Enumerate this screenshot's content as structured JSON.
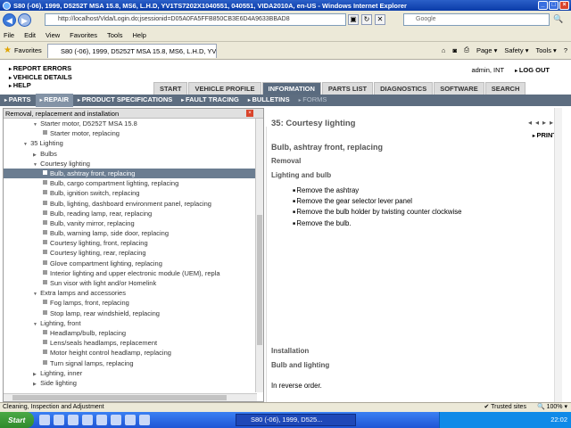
{
  "window": {
    "title": "S80 (-06), 1999, D5252T MSA 15.8, MS6, L.H.D, YV1TS7202X1040551, 040551, VIDA2010A, en-US - Windows Internet Explorer"
  },
  "browser": {
    "url": "http://localhost/Vida/Login.do;jsessionid=D05A0FA5FFB850CB3E6D4A9633BBAD8",
    "search_placeholder": "Google",
    "menu": [
      "File",
      "Edit",
      "View",
      "Favorites",
      "Tools",
      "Help"
    ],
    "favorites_label": "Favorites",
    "tab_title": "S80 (-06), 1999, D5252T MSA 15.8, MS6, L.H.D, YV1...",
    "tools": [
      "Page ▾",
      "Safety ▾",
      "Tools ▾"
    ]
  },
  "header": {
    "links": [
      "REPORT ERRORS",
      "VEHICLE DETAILS",
      "HELP"
    ],
    "user": "admin, INT",
    "logout": "LOG OUT"
  },
  "main_tabs": [
    {
      "label": "START",
      "active": false
    },
    {
      "label": "VEHICLE PROFILE",
      "active": false
    },
    {
      "label": "INFORMATION",
      "active": true
    },
    {
      "label": "PARTS LIST",
      "active": false
    },
    {
      "label": "DIAGNOSTICS",
      "active": false
    },
    {
      "label": "SOFTWARE",
      "active": false
    },
    {
      "label": "SEARCH",
      "active": false
    }
  ],
  "sub_nav": [
    {
      "label": "PARTS",
      "state": "normal"
    },
    {
      "label": "REPAIR",
      "state": "active"
    },
    {
      "label": "PRODUCT SPECIFICATIONS",
      "state": "normal"
    },
    {
      "label": "FAULT TRACING",
      "state": "normal"
    },
    {
      "label": "BULLETINS",
      "state": "normal"
    },
    {
      "label": "FORMS",
      "state": "disabled"
    }
  ],
  "left_panel": {
    "title": "Removal, replacement and installation",
    "tree": [
      {
        "label": "Starter motor, D5252T MSA 15.8",
        "depth": 1,
        "kind": "open"
      },
      {
        "label": "Starter motor, replacing",
        "depth": 2,
        "kind": "leaf"
      },
      {
        "label": "35 Lighting",
        "depth": 0,
        "kind": "open"
      },
      {
        "label": "Bulbs",
        "depth": 1,
        "kind": "closed"
      },
      {
        "label": "Courtesy lighting",
        "depth": 1,
        "kind": "open"
      },
      {
        "label": "Bulb, ashtray front, replacing",
        "depth": 2,
        "kind": "leaf",
        "selected": true
      },
      {
        "label": "Bulb, cargo compartment lighting, replacing",
        "depth": 2,
        "kind": "leaf"
      },
      {
        "label": "Bulb, ignition switch, replacing",
        "depth": 2,
        "kind": "leaf"
      },
      {
        "label": "Bulb, lighting, dashboard environment panel, replacing",
        "depth": 2,
        "kind": "leaf"
      },
      {
        "label": "Bulb, reading lamp, rear, replacing",
        "depth": 2,
        "kind": "leaf"
      },
      {
        "label": "Bulb, vanity mirror, replacing",
        "depth": 2,
        "kind": "leaf"
      },
      {
        "label": "Bulb, warning lamp, side door, replacing",
        "depth": 2,
        "kind": "leaf"
      },
      {
        "label": "Courtesy lighting, front, replacing",
        "depth": 2,
        "kind": "leaf"
      },
      {
        "label": "Courtesy lighting, rear, replacing",
        "depth": 2,
        "kind": "leaf"
      },
      {
        "label": "Glove compartment lighting, replacing",
        "depth": 2,
        "kind": "leaf"
      },
      {
        "label": "Interior lighting and upper electronic module (UEM), repla",
        "depth": 2,
        "kind": "leaf"
      },
      {
        "label": "Sun visor with light and/or Homelink",
        "depth": 2,
        "kind": "leaf"
      },
      {
        "label": "Extra lamps and accessories",
        "depth": 1,
        "kind": "open"
      },
      {
        "label": "Fog lamps, front, replacing",
        "depth": 2,
        "kind": "leaf"
      },
      {
        "label": "Stop lamp, rear windshield, replacing",
        "depth": 2,
        "kind": "leaf"
      },
      {
        "label": "Lighting, front",
        "depth": 1,
        "kind": "open"
      },
      {
        "label": "Headlamp/bulb, replacing",
        "depth": 2,
        "kind": "leaf"
      },
      {
        "label": "Lens/seals headlamps, replacement",
        "depth": 2,
        "kind": "leaf"
      },
      {
        "label": "Motor height control headlamp, replacing",
        "depth": 2,
        "kind": "leaf"
      },
      {
        "label": "Turn signal lamps, replacing",
        "depth": 2,
        "kind": "leaf"
      },
      {
        "label": "Lighting, inner",
        "depth": 1,
        "kind": "closed"
      },
      {
        "label": "Side lighting",
        "depth": 1,
        "kind": "closed"
      }
    ]
  },
  "right_panel": {
    "title": "35: Courtesy lighting",
    "print": "PRINT",
    "heading": "Bulb, ashtray front, replacing",
    "removal": "Removal",
    "removal_sub": "Lighting and bulb",
    "steps": [
      "Remove the ashtray",
      "Remove the gear selector lever panel",
      "Remove the bulb holder by twisting counter clockwise",
      "Remove the bulb."
    ],
    "installation": "Installation",
    "installation_sub": "Bulb and lighting",
    "installation_text": "In reverse order."
  },
  "status": {
    "text": "Cleaning, Inspection and Adjustment",
    "zone": "Trusted sites",
    "zoom": "100%"
  },
  "taskbar": {
    "start": "Start",
    "task": "S80 (-06), 1999, D525...",
    "clock": "22:02"
  }
}
